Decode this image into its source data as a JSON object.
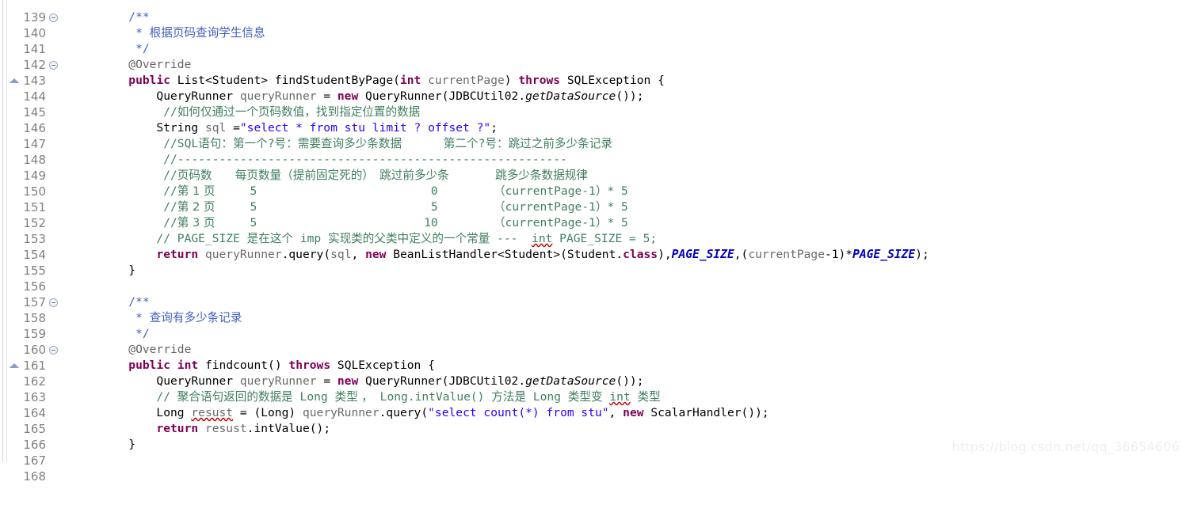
{
  "editor": {
    "app": "eclipse-java-editor",
    "language": "Java",
    "watermark": "https://blog.csdn.net/qq_36654606",
    "colors": {
      "background": "#ffffff",
      "keyword": "#7f0055",
      "string": "#2a00ff",
      "line_comment": "#3f7f5f",
      "javadoc": "#3f5fbf",
      "annotation": "#646464",
      "local_variable": "#6a6a6a",
      "static_field": "#0000c0",
      "line_number": "#808080",
      "gutter_rule": "#cfd3dd"
    },
    "first_line": 139,
    "last_line": 168,
    "lines": [
      {
        "n": 139,
        "clipped": true,
        "fold": false,
        "override": false,
        "indent": 0,
        "text": ""
      },
      {
        "n": 140,
        "fold": true,
        "override": false,
        "text": "/**"
      },
      {
        "n": 141,
        "fold": false,
        "override": false,
        "text": " * 根据页码查询学生信息"
      },
      {
        "n": 142,
        "fold": false,
        "override": false,
        "text": " */"
      },
      {
        "n": 143,
        "fold": true,
        "override": false,
        "text": "@Override"
      },
      {
        "n": 144,
        "fold": false,
        "override": true,
        "text": "public List<Student> findStudentByPage(int currentPage) throws SQLException {"
      },
      {
        "n": 145,
        "fold": false,
        "override": false,
        "text": "    QueryRunner queryRunner = new QueryRunner(JDBCUtil02.getDataSource());"
      },
      {
        "n": 146,
        "fold": false,
        "override": false,
        "text": "     //如何仅通过一个页码数值，找到指定位置的数据"
      },
      {
        "n": 147,
        "fold": false,
        "override": false,
        "text": "    String sql =\"select * from stu limit ? offset ?\";"
      },
      {
        "n": 148,
        "fold": false,
        "override": false,
        "text": "     //SQL语句：第一个?号：需要查询多少条数据      第二个?号：跳过之前多少条记录"
      },
      {
        "n": 149,
        "fold": false,
        "override": false,
        "text": "     //--------------------------------------------------------"
      },
      {
        "n": 150,
        "fold": false,
        "override": false,
        "text": "     //页码数    每页数量（提前固定死的）   跳过前多少条       跳多少条数据规律"
      },
      {
        "n": 151,
        "fold": false,
        "override": false,
        "text": "     //第 1 页     5                          0           （currentPage-1）* 5"
      },
      {
        "n": 152,
        "fold": false,
        "override": false,
        "text": "     //第 2 页     5                          5           （currentPage-1）* 5"
      },
      {
        "n": 153,
        "fold": false,
        "override": false,
        "text": "     //第 3 页     5                         10           （currentPage-1）* 5"
      },
      {
        "n": 154,
        "fold": false,
        "override": false,
        "text": "    // PAGE_SIZE 是在这个 imp 实现类的父类中定义的一个常量 ---  int PAGE_SIZE = 5;"
      },
      {
        "n": 155,
        "fold": false,
        "override": false,
        "text": "    return queryRunner.query(sql, new BeanListHandler<Student>(Student.class),PAGE_SIZE,(currentPage-1)*PAGE_SIZE);"
      },
      {
        "n": 156,
        "fold": false,
        "override": false,
        "text": "}"
      },
      {
        "n": 157,
        "fold": false,
        "override": false,
        "text": ""
      },
      {
        "n": 158,
        "fold": true,
        "override": false,
        "text": "/**"
      },
      {
        "n": 159,
        "fold": false,
        "override": false,
        "text": " * 查询有多少条记录"
      },
      {
        "n": 160,
        "fold": false,
        "override": false,
        "text": " */"
      },
      {
        "n": 161,
        "fold": true,
        "override": false,
        "text": "@Override"
      },
      {
        "n": 162,
        "fold": false,
        "override": true,
        "text": "public int findcount() throws SQLException {"
      },
      {
        "n": 163,
        "fold": false,
        "override": false,
        "text": "    QueryRunner queryRunner = new QueryRunner(JDBCUtil02.getDataSource());"
      },
      {
        "n": 164,
        "fold": false,
        "override": false,
        "text": "    // 聚合语句返回的数据是 Long 类型 ， Long.intValue() 方法是 Long 类型变 int 类型"
      },
      {
        "n": 165,
        "fold": false,
        "override": false,
        "text": "    Long resust = (Long) queryRunner.query(\"select count(*) from stu\", new ScalarHandler());"
      },
      {
        "n": 166,
        "fold": false,
        "override": false,
        "text": "    return resust.intValue();"
      },
      {
        "n": 167,
        "fold": false,
        "override": false,
        "text": "}"
      },
      {
        "n": 168,
        "fold": false,
        "override": false,
        "text": ""
      }
    ]
  }
}
